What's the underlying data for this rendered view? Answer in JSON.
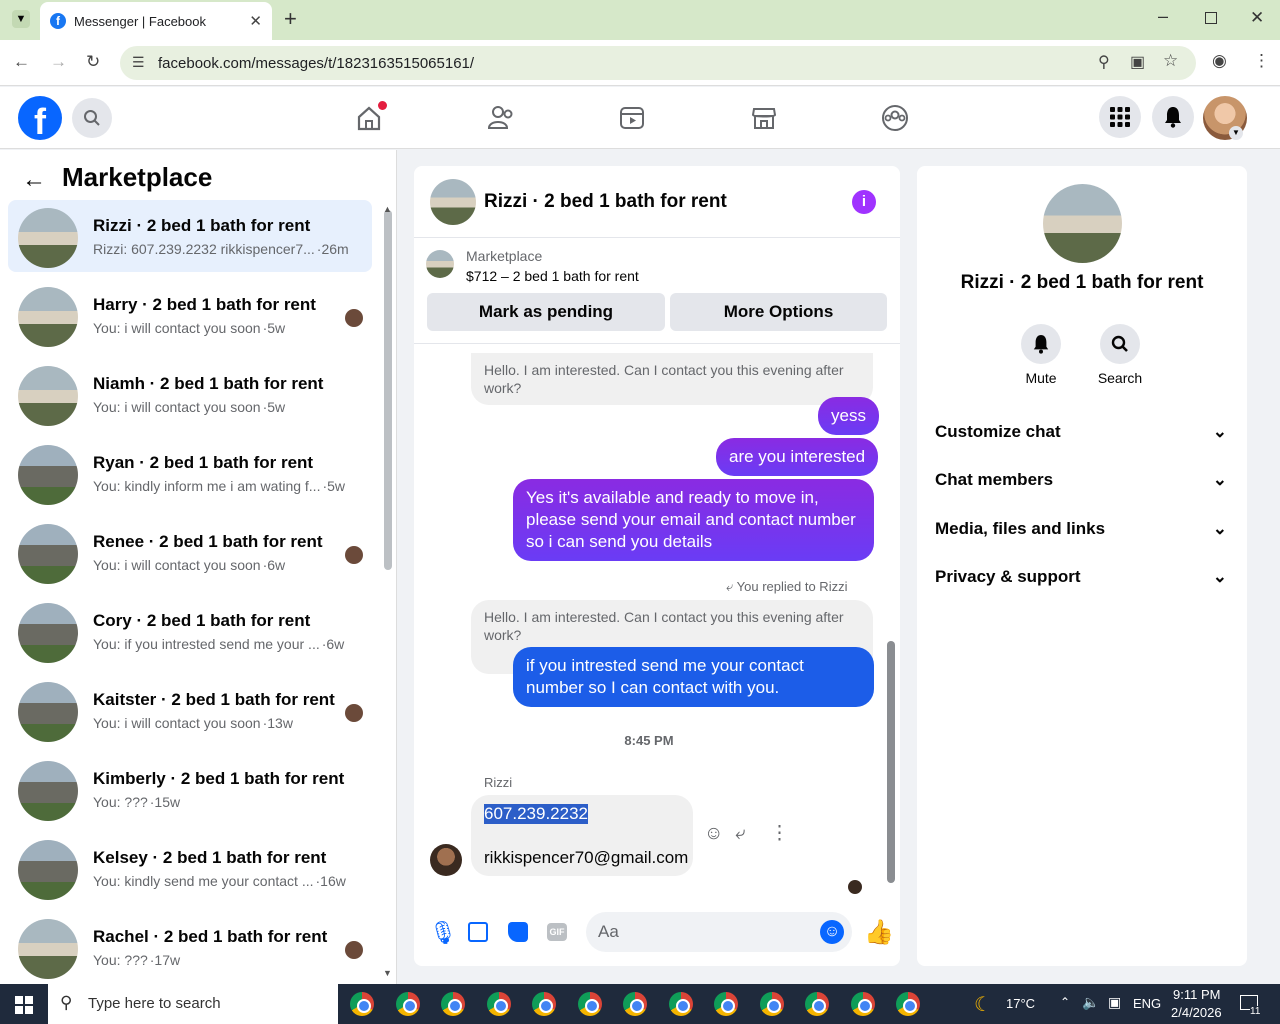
{
  "browser": {
    "tab_title": "Messenger | Facebook",
    "tab_favicon_letter": "f",
    "new_tab_symbol": "+",
    "url": "facebook.com/messages/t/1823163515065161/"
  },
  "fb": {
    "logo_letter": "f"
  },
  "left": {
    "title": "Marketplace",
    "conversations": [
      {
        "title": "Rizzi · 2 bed 1 bath for rent",
        "preview": "Rizzi: 607.239.2232 rikkispencer7...",
        "time": "·26m",
        "selected": true
      },
      {
        "title": "Harry · 2 bed 1 bath for rent",
        "preview": "You: i will contact you soon",
        "time": "·5w"
      },
      {
        "title": "Niamh · 2 bed 1 bath for rent",
        "preview": "You: i will contact you soon",
        "time": "·5w"
      },
      {
        "title": "Ryan · 2 bed 1 bath for rent",
        "preview": "You: kindly inform me i am wating f...",
        "time": "·5w"
      },
      {
        "title": "Renee · 2 bed 1 bath for rent",
        "preview": "You: i will contact you soon",
        "time": "·6w"
      },
      {
        "title": "Cory · 2 bed 1 bath for rent",
        "preview": "You: if you intrested send me your ...",
        "time": "·6w"
      },
      {
        "title": "Kaitster · 2 bed 1 bath for rent",
        "preview": "You: i will contact you soon",
        "time": "·13w"
      },
      {
        "title": "Kimberly · 2 bed 1 bath for rent",
        "preview": "You: ???",
        "time": "·15w"
      },
      {
        "title": "Kelsey · 2 bed 1 bath for rent",
        "preview": "You: kindly send me your contact ...",
        "time": "·16w"
      },
      {
        "title": "Rachel · 2 bed 1 bath for rent",
        "preview": "You: ???",
        "time": "·17w"
      }
    ]
  },
  "chat": {
    "title": "Rizzi · 2 bed 1 bath for rent",
    "info_symbol": "i",
    "listing_label": "Marketplace",
    "listing_price": "$712 – 2 bed 1 bath for rent",
    "mark_pending": "Mark as pending",
    "more_options": "More Options",
    "msg1": "Hello. I am interested. Can I contact you this evening after work?",
    "msg2": "yess",
    "msg3": "are you interested",
    "msg4": "Yes it's available and ready to move in, please send your email and contact number so i can send you details",
    "replied_to": "You replied to Rizzi",
    "msg5_quote": "Hello. I am interested. Can I contact you this evening after work?",
    "msg5": "if you intrested send me your contact number so I can contact with you.",
    "timestamp": "8:45 PM",
    "sender": "Rizzi",
    "phone": "607.239.2232",
    "email": "rikkispencer70@gmail.com",
    "composer_placeholder": "Aa"
  },
  "right": {
    "name": "Rizzi · 2 bed 1 bath for rent",
    "mute": "Mute",
    "search": "Search",
    "sections": [
      "Customize chat",
      "Chat members",
      "Media, files and links",
      "Privacy & support"
    ]
  },
  "taskbar": {
    "search_placeholder": "Type here to search",
    "weather": "17°C",
    "lang": "ENG",
    "time": "9:11 PM",
    "date": "2/4/2026",
    "notif_count": "11"
  },
  "colors": {
    "accent": "#0866ff",
    "bubble_purple": "#7b35ee",
    "bubble_blue": "#1c5de8",
    "selected_row": "#e7f0fd"
  }
}
